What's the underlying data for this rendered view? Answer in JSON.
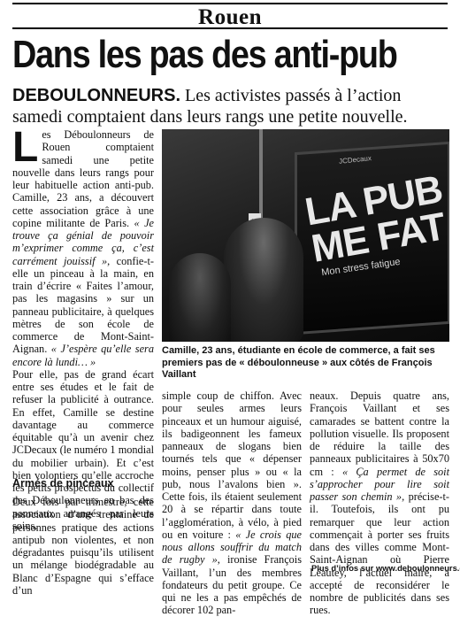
{
  "section": {
    "title": "Rouen"
  },
  "headline": "Dans les pas des anti-pub",
  "deck": {
    "kicker": "DEBOULONNEURS.",
    "text": " Les activistes passés à l’action samedi comptaient dans leurs rangs une petite nouvelle."
  },
  "photo": {
    "poster_text_line1": "LA PUB",
    "poster_text_line2": "ME FAT",
    "poster_sub": "Mon stress fatigue",
    "poster_brand": "JCDecaux",
    "sign": "P",
    "caption": "Camille, 23 ans, étudiante en école de commerce, a fait ses premiers pas de « déboulonneuse » aux côtés de François Vaillant"
  },
  "body": {
    "dropcap": "L",
    "p1_a": "es Déboulonneurs de Rouen comptaient samedi une petite nouvelle dans leurs rangs pour leur habituelle action anti-pub. Camille, 23 ans, a découvert cette association grâce à une copine militante de Paris. ",
    "p1_quote1": "« Je trouve ça génial de pouvoir m’exprimer comme ça, c’est carrément jouissif »",
    "p1_b": ", confie-t-elle un pinceau à la main, en train d’écrire « Faites l’amour, pas les magasins » sur un panneau publicitaire, à quelques mètres de son école de commerce de Mont-Saint-Aignan. ",
    "p1_quote2": "« J’espère qu’elle sera encore là lundi… »",
    "p2": "Pour elle, pas de grand écart entre ses études et le fait de refuser la publicité à outrance. En effet, Camille se destine davantage au commerce équitable qu’à un avenir chez JCDecaux (le numéro 1 mondial du mobilier urbain). Et c’est bien volontiers qu’elle accroche les petits prospectus du collectif des Déboulonneurs en bas des panneaux arrangés par leurs soins.",
    "subhead": "Armés de pinceaux",
    "p3": "Deux fois par trimestre, cette association d’une trentaine de personnes pratique des actions antipub non violentes, et non dégradantes puisqu’ils utilisent un mélange biodégradable au Blanc d’Espagne qui s’efface d’un",
    "p4_a": "simple coup de chiffon. Avec pour seules armes leurs pinceaux et un humour aiguisé, ils badigeonnent les fameux panneaux de slogans bien tournés tels que « dépenser moins, penser plus » ou « la pub, nous l’avalons bien ». Cette fois, ils étaient seulement 20 à se répartir dans toute l’agglomération, à vélo, à pied ou en voiture : ",
    "p4_quote": "« Je crois que nous allons souffrir du match de rugby »",
    "p4_b": ", ironise François Vaillant, l’un des membres fondateurs du petit groupe. Ce qui ne les a pas empêchés de décorer 102 pan-",
    "p5_a": "neaux. Depuis quatre ans, François Vaillant et ses camarades se battent contre la pollution visuelle. Ils proposent de réduire la taille des panneaux publicitaires à 50x70 cm : ",
    "p5_quote": "« Ça permet de soit s’approcher pour lire soit passer son chemin »",
    "p5_b": ", précise-t-il. Toutefois, ils ont pu remarquer que leur action commençait à porter ses fruits dans des villes comme Mont-Saint-Aignan où Pierre Léautey, l’actuel maire, a accepté de reconsidérer le nombre de publicités dans ses rues.",
    "plus_info_label": "Plus d’infos sur ",
    "plus_info_url": "www.deboulonneurs.org."
  }
}
